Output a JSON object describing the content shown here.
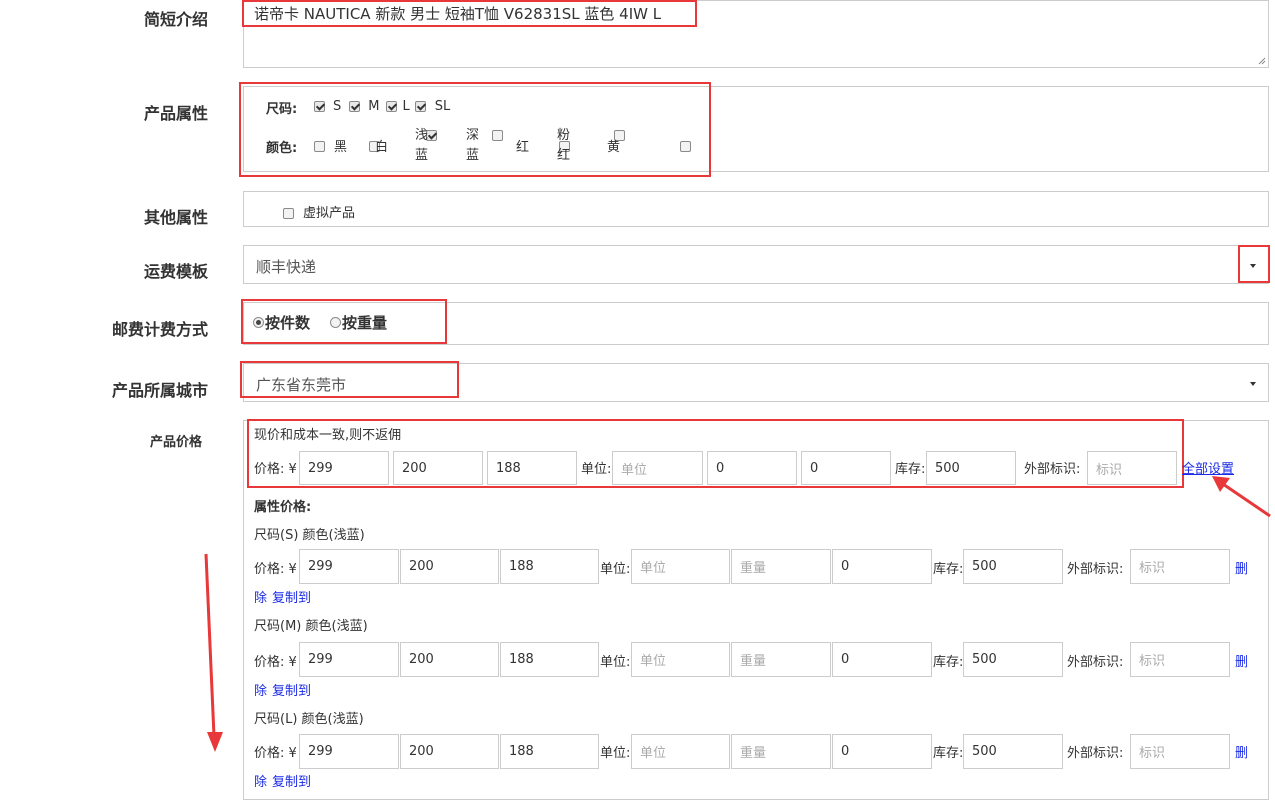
{
  "intro": {
    "label": "简短介绍",
    "value": "诺帝卡 NAUTICA 新款 男士 短袖T恤 V62831SL 蓝色 4IW L"
  },
  "attrs": {
    "label": "产品属性",
    "size_label": "尺码:",
    "sizes": [
      {
        "name": "S",
        "checked": true
      },
      {
        "name": "M",
        "checked": true
      },
      {
        "name": "L",
        "checked": true
      },
      {
        "name": "SL",
        "checked": true
      }
    ],
    "color_label": "颜色:",
    "colors": [
      {
        "l1": "黑",
        "l2": "",
        "checked": false
      },
      {
        "l1": "白",
        "l2": "",
        "checked": false
      },
      {
        "l1": "浅",
        "l2": "蓝",
        "checked": true
      },
      {
        "l1": "深",
        "l2": "蓝",
        "checked": false
      },
      {
        "l1": "红",
        "l2": "",
        "checked": false
      },
      {
        "l1": "粉",
        "l2": "红",
        "checked": false
      },
      {
        "l1": "黄",
        "l2": "",
        "checked": false
      }
    ]
  },
  "other": {
    "label": "其他属性",
    "virtual_label": "虚拟产品",
    "virtual_checked": false
  },
  "shipping": {
    "label": "运费模板",
    "value": "顺丰快递"
  },
  "postage": {
    "label": "邮费计费方式",
    "options": [
      {
        "name": "按件数",
        "selected": true
      },
      {
        "name": "按重量",
        "selected": false
      }
    ]
  },
  "city": {
    "label": "产品所属城市",
    "value": "广东省东莞市"
  },
  "price": {
    "label": "产品价格",
    "note": "现价和成本一致,则不返佣",
    "price_label": "价格: ¥",
    "price_values": [
      "299",
      "200",
      "188"
    ],
    "unit_label": "单位:",
    "unit_placeholder": "单位",
    "weight_placeholder": "重量",
    "main_extra": [
      "0",
      "0"
    ],
    "stock_label": "库存:",
    "stock_value": "500",
    "ext_label": "外部标识:",
    "ext_placeholder": "标识",
    "set_all": "全部设置",
    "attr_price_label": "属性价格:",
    "delete_a": "删",
    "delete_b": "除",
    "copy_to": "复制到",
    "variants": [
      {
        "title": "尺码(S) 颜色(浅蓝)",
        "prices": [
          "299",
          "200",
          "188"
        ],
        "extra": "0",
        "stock": "500"
      },
      {
        "title": "尺码(M) 颜色(浅蓝)",
        "prices": [
          "299",
          "200",
          "188"
        ],
        "extra": "0",
        "stock": "500"
      },
      {
        "title": "尺码(L) 颜色(浅蓝)",
        "prices": [
          "299",
          "200",
          "188"
        ],
        "extra": "0",
        "stock": "500"
      }
    ]
  },
  "colors": {
    "highlight": "#e8383a",
    "link": "#1a2ae8",
    "border": "#cccccc"
  }
}
